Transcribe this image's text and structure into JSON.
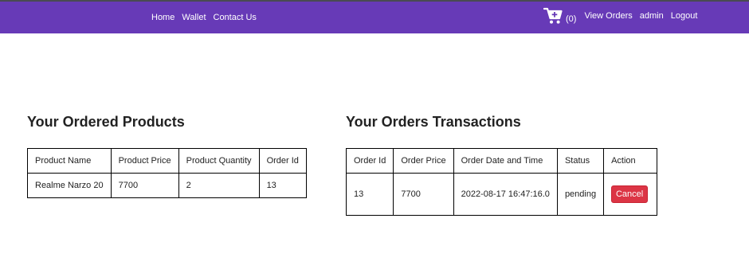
{
  "navbar": {
    "left_links": [
      "Home",
      "Wallet",
      "Contact Us"
    ],
    "cart_icon": "cart-plus-icon",
    "cart_count": "(0)",
    "right_links": [
      "View Orders",
      "admin",
      "Logout"
    ],
    "background": "#673ab7"
  },
  "ordered_products": {
    "title": "Your Ordered Products",
    "headers": [
      "Product Name",
      "Product Price",
      "Product Quantity",
      "Order Id"
    ],
    "rows": [
      [
        "Realme Narzo 20",
        "7700",
        "2",
        "13"
      ]
    ]
  },
  "transactions": {
    "title": "Your Orders Transactions",
    "headers": [
      "Order Id",
      "Order Price",
      "Order Date and Time",
      "Status",
      "Action"
    ],
    "rows": [
      {
        "order_id": "13",
        "order_price": "7700",
        "date_time": "2022-08-17 16:47:16.0",
        "status": "pending",
        "action_label": "Cancel"
      }
    ]
  },
  "colors": {
    "cancel_button": "#dc3545"
  }
}
